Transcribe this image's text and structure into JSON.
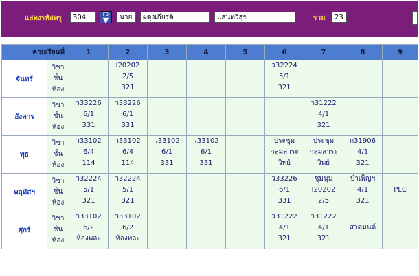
{
  "header": {
    "teacher_code_label": "แสดงรหัสครู",
    "teacher_code": "304",
    "f3_label": "F3",
    "prefix": "นาย",
    "first_name": "ผดุงเกียรติ",
    "last_name": "แสนทวีสุข",
    "total_label": "รวม",
    "total": "23"
  },
  "table": {
    "corner_label": "คาบเรียนที่",
    "periods": [
      "1",
      "2",
      "3",
      "4",
      "5",
      "6",
      "7",
      "8",
      "9"
    ],
    "row_labels": [
      "วิชา",
      "ชั้น",
      "ห้อง"
    ],
    "days": [
      {
        "name": "จันทร์",
        "cells": [
          [
            "",
            "",
            ""
          ],
          [
            "I20202",
            "2/5",
            "321"
          ],
          [
            "",
            "",
            ""
          ],
          [
            "",
            "",
            ""
          ],
          [
            "",
            "",
            ""
          ],
          [
            "ว32224",
            "5/1",
            "321"
          ],
          [
            "",
            "",
            ""
          ],
          [
            "",
            "",
            ""
          ],
          [
            "",
            "",
            ""
          ]
        ]
      },
      {
        "name": "อังคาร",
        "cells": [
          [
            "ว33226",
            "6/1",
            "331"
          ],
          [
            "ว33226",
            "6/1",
            "331"
          ],
          [
            "",
            "",
            ""
          ],
          [
            "",
            "",
            ""
          ],
          [
            "",
            "",
            ""
          ],
          [
            "",
            "",
            ""
          ],
          [
            "ว31222",
            "4/1",
            "321"
          ],
          [
            "",
            "",
            ""
          ],
          [
            "",
            "",
            ""
          ]
        ]
      },
      {
        "name": "พุธ",
        "cells": [
          [
            "ว33102",
            "6/4",
            "114"
          ],
          [
            "ว33102",
            "6/4",
            "114"
          ],
          [
            "ว33102",
            "6/1",
            "331"
          ],
          [
            "ว33102",
            "6/1",
            "331"
          ],
          [
            "",
            "",
            ""
          ],
          [
            "ประชุม",
            "กลุ่มสาระ",
            "วิทย์"
          ],
          [
            "ประชุม",
            "กลุ่มสาระ",
            "วิทย์"
          ],
          [
            "ก31906",
            "4/1",
            "321"
          ],
          [
            "",
            "",
            ""
          ]
        ]
      },
      {
        "name": "พฤหัสฯ",
        "cells": [
          [
            "ว32224",
            "5/1",
            "321"
          ],
          [
            "ว32224",
            "5/1",
            "321"
          ],
          [
            "",
            "",
            ""
          ],
          [
            "",
            "",
            ""
          ],
          [
            "",
            "",
            ""
          ],
          [
            "ว33226",
            "6/1",
            "331"
          ],
          [
            "ชุมนุม",
            "I20202",
            "2/5"
          ],
          [
            "บำเพ็ญฯ",
            "4/1",
            "321"
          ],
          [
            ".",
            "PLC",
            "."
          ]
        ]
      },
      {
        "name": "ศุกร์",
        "cells": [
          [
            "ว33102",
            "6/2",
            "ห้องพละ"
          ],
          [
            "ว33102",
            "6/2",
            "ห้องพละ"
          ],
          [
            "",
            "",
            ""
          ],
          [
            "",
            "",
            ""
          ],
          [
            "",
            "",
            ""
          ],
          [
            "ว31222",
            "4/1",
            "321"
          ],
          [
            "ว31222",
            "4/1",
            "321"
          ],
          [
            ".",
            "สวดมนต์",
            "."
          ],
          [
            "",
            "",
            ""
          ]
        ]
      }
    ]
  }
}
